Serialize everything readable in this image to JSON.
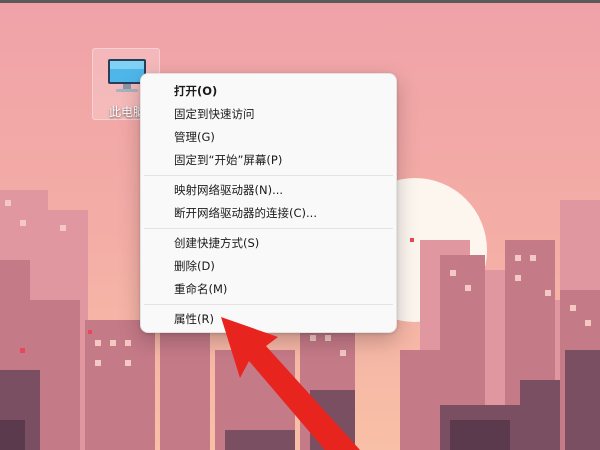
{
  "desktop": {
    "icons": [
      {
        "label": "此电脑",
        "icon": "this-pc-monitor-icon"
      }
    ]
  },
  "context_menu": {
    "groups": [
      {
        "items": [
          "打开(O)",
          "固定到快速访问",
          "管理(G)",
          "固定到“开始”屏幕(P)"
        ]
      },
      {
        "items": [
          "映射网络驱动器(N)...",
          "断开网络驱动器的连接(C)..."
        ]
      },
      {
        "items": [
          "创建快捷方式(S)",
          "删除(D)",
          "重命名(M)"
        ]
      },
      {
        "items": [
          "属性(R)"
        ]
      }
    ]
  },
  "annotation": {
    "type": "arrow",
    "color": "#e8241f",
    "points_to": "属性(R)"
  },
  "colors": {
    "sky_top": "#f0a2a8",
    "sky_bottom": "#f6b8a4",
    "sun": "#fdf6ef",
    "buildings_far": "#d98890",
    "buildings_mid": "#b9707f",
    "buildings_near": "#6b4558",
    "menu_bg": "#f9f9f9"
  }
}
